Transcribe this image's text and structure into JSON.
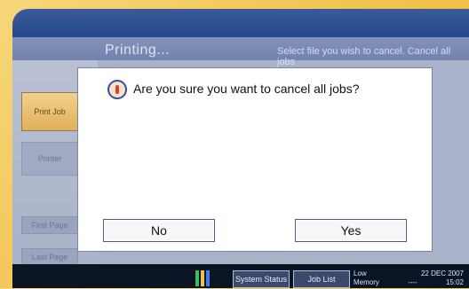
{
  "screen": {
    "title": "Printing...",
    "title_right": "Select file you wish to cancel. Cancel all jobs"
  },
  "left_panel": {
    "btn1": "Print Job",
    "btn2": "Printer",
    "btn3": "First Page",
    "btn4": "Last Page"
  },
  "dialog": {
    "message": "Are you sure you want to cancel all jobs?",
    "no_label": "No",
    "yes_label": "Yes"
  },
  "taskbar": {
    "btn1": "System Status",
    "btn2": "Job List",
    "status": {
      "line1_left": "Low",
      "line1_right": "22 DEC 2007",
      "line2_left": "Memory",
      "line2_mid": "----",
      "line2_right": "15:02"
    }
  }
}
